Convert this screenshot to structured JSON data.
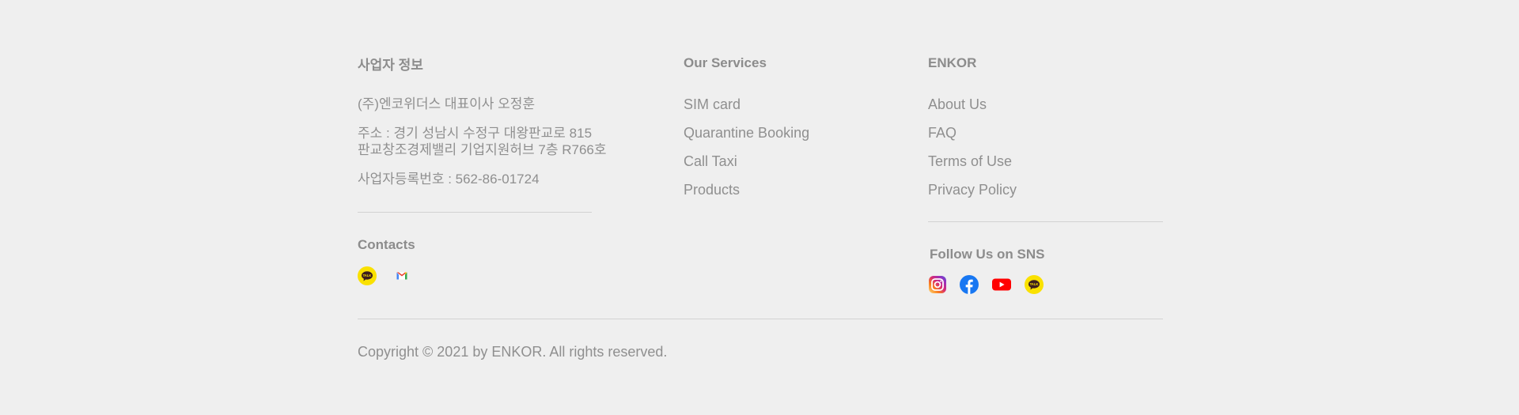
{
  "business": {
    "heading": "사업자 정보",
    "company": "(주)엔코위더스 대표이사 오정훈",
    "address_line1": "주소 : 경기 성남시 수정구 대왕판교로 815",
    "address_line2": "판교창조경제밸리 기업지원허브 7층 R766호",
    "registration": "사업자등록번호 : 562-86-01724"
  },
  "contacts": {
    "heading": "Contacts",
    "icons": [
      "kakaotalk-icon",
      "gmail-icon"
    ]
  },
  "services": {
    "heading": "Our Services",
    "links": [
      "SIM card",
      "Quarantine Booking",
      "Call Taxi",
      "Products"
    ]
  },
  "enkor": {
    "heading": "ENKOR",
    "links": [
      "About Us",
      "FAQ",
      "Terms of Use",
      "Privacy Policy"
    ]
  },
  "sns": {
    "heading": "Follow Us on SNS",
    "icons": [
      "instagram-icon",
      "facebook-icon",
      "youtube-icon",
      "kakaotalk-icon"
    ]
  },
  "colors": {
    "background": "#efefef",
    "text": "#8f8f8f",
    "divider": "#d2d2d2",
    "kakao_yellow": "#fae100",
    "facebook_blue": "#1877f2",
    "youtube_red": "#ff0000"
  },
  "copyright": "Copyright © 2021 by ENKOR. All rights reserved."
}
